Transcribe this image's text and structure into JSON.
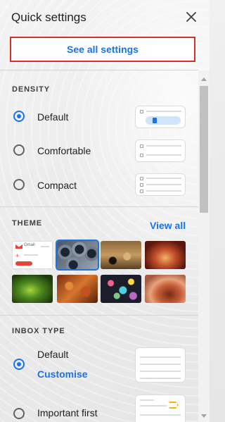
{
  "header": {
    "title": "Quick settings",
    "close_icon": "close-icon"
  },
  "see_all": {
    "label": "See all settings",
    "border_color": "#d93025"
  },
  "density": {
    "label": "DENSITY",
    "options": [
      {
        "label": "Default",
        "selected": true
      },
      {
        "label": "Comfortable",
        "selected": false
      },
      {
        "label": "Compact",
        "selected": false
      }
    ]
  },
  "theme": {
    "label": "THEME",
    "view_all": "View all",
    "gmail_text": "Gmail",
    "thumbnails": [
      {
        "name": "theme-default",
        "selected": false
      },
      {
        "name": "theme-pipes",
        "selected": true
      },
      {
        "name": "theme-chess",
        "selected": false
      },
      {
        "name": "theme-canyon",
        "selected": false
      },
      {
        "name": "theme-leaf",
        "selected": false
      },
      {
        "name": "theme-autumn",
        "selected": false
      },
      {
        "name": "theme-bokeh",
        "selected": false
      },
      {
        "name": "theme-desert",
        "selected": false
      }
    ]
  },
  "inbox_type": {
    "label": "INBOX TYPE",
    "options": [
      {
        "label": "Default",
        "selected": true,
        "action": "Customise"
      },
      {
        "label": "Important first",
        "selected": false
      }
    ]
  },
  "colors": {
    "accent": "#1a73e8",
    "highlight": "#d93025"
  }
}
